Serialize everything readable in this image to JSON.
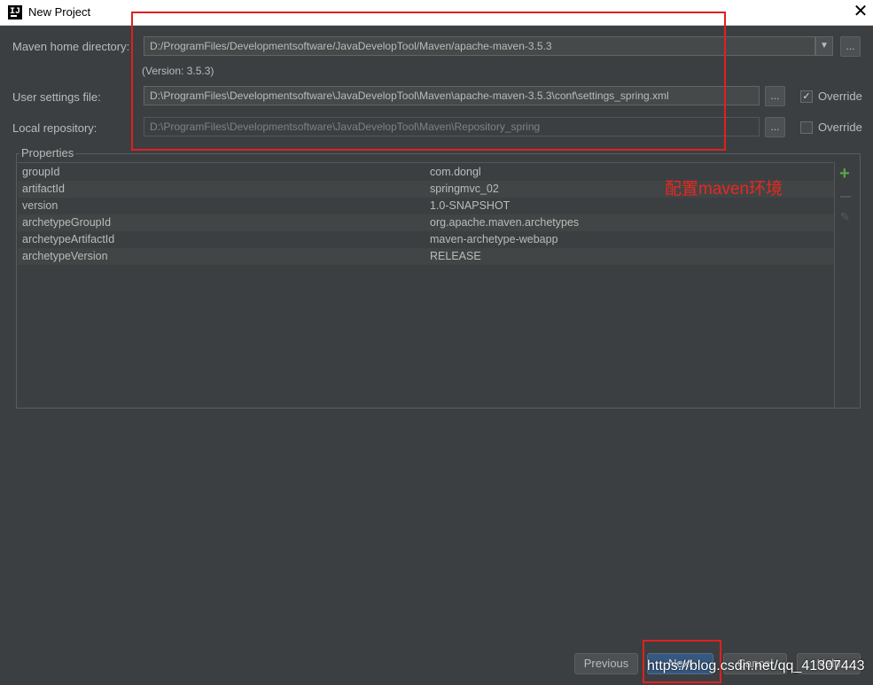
{
  "window": {
    "title": "New Project",
    "close_glyph": "✕"
  },
  "maven_home": {
    "label": "Maven home directory:",
    "value": "D:/ProgramFiles/Developmentsoftware/JavaDevelopTool/Maven/apache-maven-3.5.3",
    "dropdown_glyph": "▼",
    "browse_label": "...",
    "version": "(Version: 3.5.3)"
  },
  "user_settings": {
    "label": "User settings file:",
    "value": "D:\\ProgramFiles\\Developmentsoftware\\JavaDevelopTool\\Maven\\apache-maven-3.5.3\\conf\\settings_spring.xml",
    "browse_label": "...",
    "override_label": "Override",
    "override_checked": true,
    "check_glyph": "✓"
  },
  "local_repo": {
    "label": "Local repository:",
    "value": "D:\\ProgramFiles\\Developmentsoftware\\JavaDevelopTool\\Maven\\Repository_spring",
    "browse_label": "...",
    "override_label": "Override",
    "override_checked": false
  },
  "properties": {
    "title": "Properties",
    "add_glyph": "+",
    "edit_glyph": "✎",
    "rows": [
      {
        "key": "groupId",
        "value": "com.dongl"
      },
      {
        "key": "artifactId",
        "value": "springmvc_02"
      },
      {
        "key": "version",
        "value": "1.0-SNAPSHOT"
      },
      {
        "key": "archetypeGroupId",
        "value": "org.apache.maven.archetypes"
      },
      {
        "key": "archetypeArtifactId",
        "value": "maven-archetype-webapp"
      },
      {
        "key": "archetypeVersion",
        "value": "RELEASE"
      }
    ]
  },
  "annotation": "配置maven环境",
  "buttons": {
    "previous": "Previous",
    "next": "Next",
    "cancel": "Cancel",
    "help": "Help"
  },
  "watermark": "https://blog.csdn.net/qq_41307443",
  "colors": {
    "background": "#3c3f41",
    "annotation": "#e8281f",
    "add_icon": "#57a64a",
    "primary_button": "#365880"
  }
}
